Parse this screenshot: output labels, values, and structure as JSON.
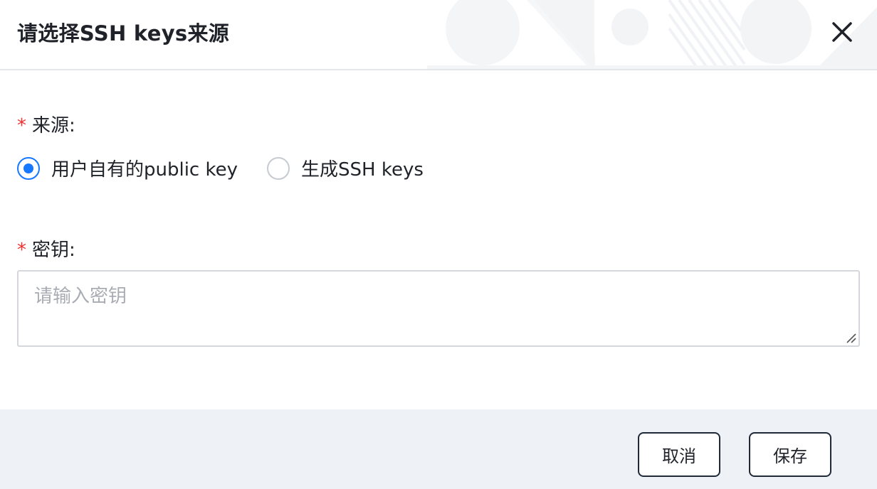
{
  "dialog": {
    "title": "请选择SSH keys来源"
  },
  "form": {
    "source": {
      "required_mark": "*",
      "label": "来源:",
      "options": [
        {
          "label": "用户自有的public key",
          "checked": true
        },
        {
          "label": "生成SSH keys",
          "checked": false
        }
      ]
    },
    "key": {
      "required_mark": "*",
      "label": "密钥:",
      "value": "",
      "placeholder": "请输入密钥"
    }
  },
  "footer": {
    "cancel_label": "取消",
    "save_label": "保存"
  },
  "icons": {
    "close": "close-icon",
    "resize": "resize-handle-icon"
  },
  "colors": {
    "accent": "#1677ff",
    "required": "#f23030",
    "footer_bg": "#eef1f6",
    "text": "#1f2329",
    "placeholder": "#a9adb3"
  }
}
